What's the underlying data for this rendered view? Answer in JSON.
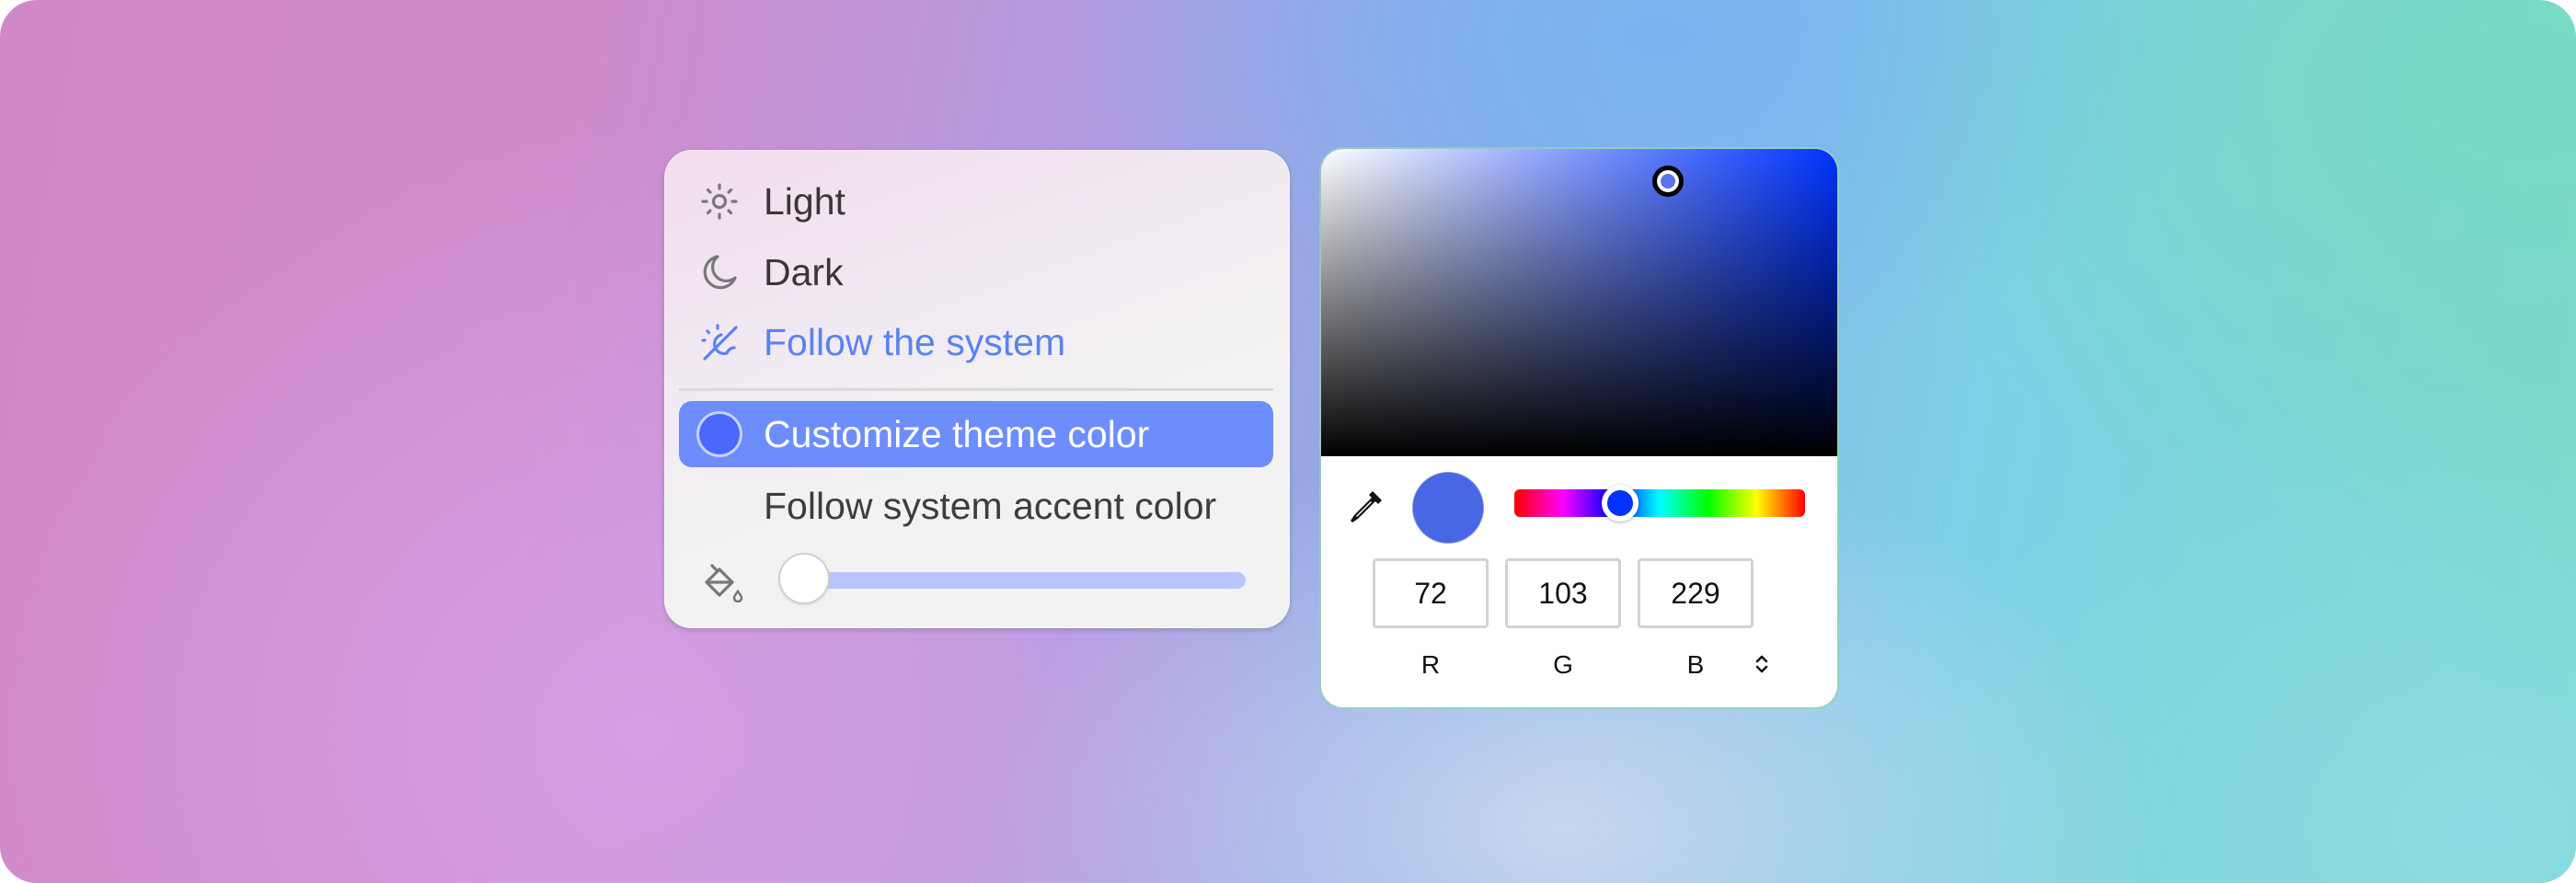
{
  "theme_menu": {
    "items": [
      {
        "id": "light",
        "label": "Light",
        "icon": "sun-icon",
        "selected": false
      },
      {
        "id": "dark",
        "label": "Dark",
        "icon": "moon-icon",
        "selected": false
      },
      {
        "id": "system",
        "label": "Follow the system",
        "icon": "auto-theme-icon",
        "selected": true
      }
    ],
    "color_options": [
      {
        "id": "custom",
        "label": "Customize theme color",
        "highlighted": true
      },
      {
        "id": "accent",
        "label": "Follow system accent color",
        "highlighted": false
      }
    ],
    "opacity_slider": {
      "icon": "paint-bucket-icon",
      "value_fraction": 0.0
    },
    "colors": {
      "accent_text": "#5b82f0",
      "highlight_bg": "#6e8dfd",
      "swatch": "#4a68fb",
      "slider_track": "#b8c6fc"
    }
  },
  "color_picker": {
    "current_color": "#4867e5",
    "hue_base": "#0033ff",
    "rgb": {
      "r": "72",
      "g": "103",
      "b": "229"
    },
    "labels": {
      "r": "R",
      "g": "G",
      "b": "B"
    },
    "mode_toggle_icon": "up-down-chevron-icon",
    "eyedropper_icon": "eyedropper-icon"
  }
}
